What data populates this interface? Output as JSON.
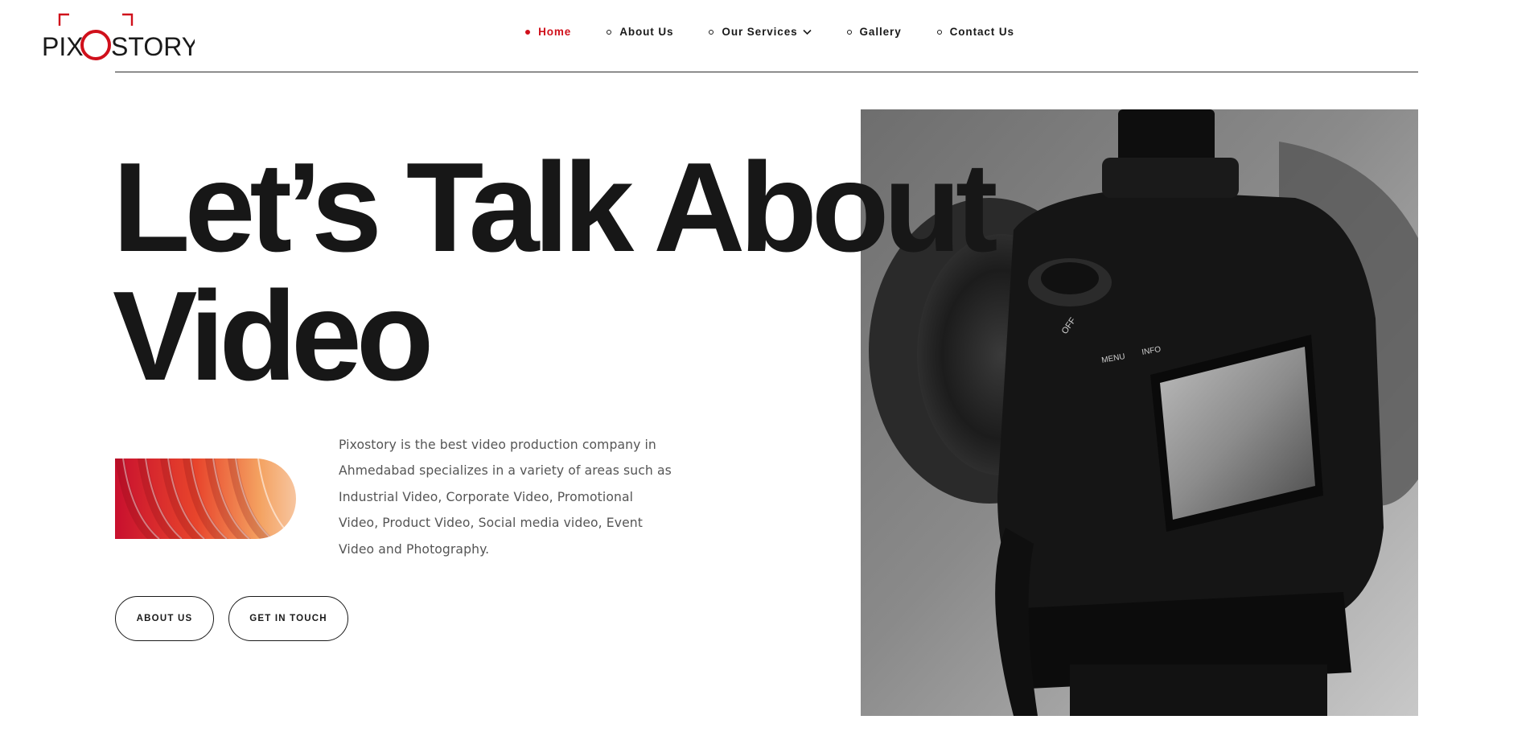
{
  "brand": {
    "name": "PIXOSTORY",
    "accent_color": "#d0101b",
    "text_color": "#1a1a1a"
  },
  "nav": {
    "items": [
      {
        "label": "Home",
        "active": true
      },
      {
        "label": "About Us",
        "active": false
      },
      {
        "label": "Our Services",
        "active": false,
        "has_dropdown": true
      },
      {
        "label": "Gallery",
        "active": false
      },
      {
        "label": "Contact Us",
        "active": false
      }
    ]
  },
  "hero": {
    "headline_line1": "Let’s Talk About",
    "headline_line2": "Video",
    "description": "Pixostory is the best video production company in Ahmedabad specializes in a variety of areas such as Industrial Video, Corporate Video, Promotional Video, Product Video, Social media video, Event Video and Photography.",
    "buttons": {
      "about": "ABOUT US",
      "touch": "GET IN TOUCH"
    },
    "image_icon": "camera-photo",
    "wave_colors": [
      "#c8102e",
      "#e8452c",
      "#f4a261",
      "#f7c59f"
    ]
  }
}
